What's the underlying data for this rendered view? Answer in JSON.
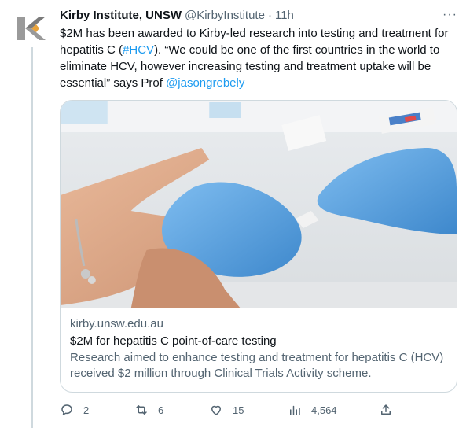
{
  "tweet": {
    "author_name": "Kirby Institute, UNSW",
    "author_handle": "@KirbyInstitute",
    "separator": "·",
    "time": "11h",
    "more_label": "···",
    "text": {
      "line1": "$2M has been awarded to Kirby-led research into testing and treatment for",
      "line2_a": "hepatitis C (",
      "line2_hashtag": "#HCV",
      "line2_b": "). “We could be one of the first countries in the world to",
      "line3": "eliminate HCV,  however increasing testing and treatment uptake will be",
      "line4_a": "essential” says Prof ",
      "line4_mention": "@jasongrebely"
    },
    "card": {
      "domain": "kirby.unsw.edu.au",
      "title": "$2M for hepatitis C point-of-care testing",
      "description_line1": "Research aimed to enhance testing and treatment for hepatitis C (HCV)",
      "description_line2": "received $2 million through Clinical Trials Activity scheme."
    },
    "actions": {
      "replies": "2",
      "retweets": "6",
      "likes": "15",
      "views": "4,564"
    },
    "icons": [
      "logo-icon",
      "more-icon",
      "reply-icon",
      "retweet-icon",
      "like-icon",
      "views-icon",
      "share-icon"
    ],
    "colors": {
      "accent": "#1d9bf0",
      "secondary_text": "#536471",
      "border": "#cfd9de",
      "glove": "#5aa6e0"
    }
  }
}
